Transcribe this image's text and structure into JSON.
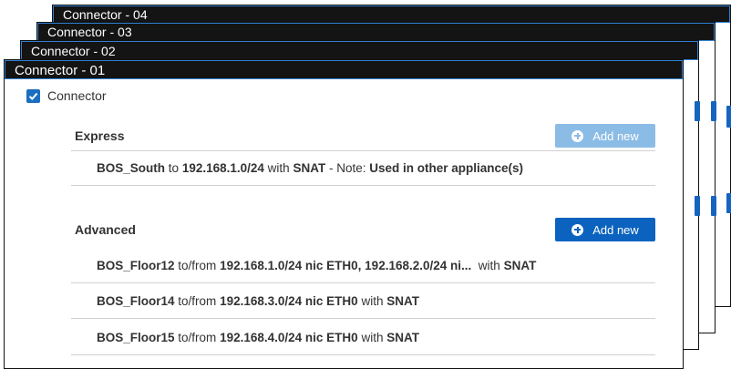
{
  "cards": [
    {
      "title": "Connector - 04"
    },
    {
      "title": "Connector - 03"
    },
    {
      "title": "Connector - 02"
    },
    {
      "title": "Connector - 01"
    }
  ],
  "connector_checkbox": {
    "label": "Connector",
    "checked": true
  },
  "express": {
    "title": "Express",
    "add_button": "Add new",
    "rows": [
      {
        "name": "BOS_South",
        "t1": "to",
        "network": "192.168.1.0/24",
        "t2": "with",
        "snat": "SNAT",
        "t3": "- Note:",
        "note": "Used in other appliance(s)"
      }
    ]
  },
  "advanced": {
    "title": "Advanced",
    "add_button": "Add new",
    "rows": [
      {
        "name": "BOS_Floor12",
        "t1": "to/from",
        "networks": "192.168.1.0/24 nic ETH0, 192.168.2.0/24 ni...",
        "t2": "with",
        "snat": "SNAT"
      },
      {
        "name": "BOS_Floor14",
        "t1": "to/from",
        "networks": "192.168.3.0/24 nic ETH0",
        "t2": "with",
        "snat": "SNAT"
      },
      {
        "name": "BOS_Floor15",
        "t1": "to/from",
        "networks": "192.168.4.0/24 nic ETH0",
        "t2": "with",
        "snat": "SNAT"
      }
    ]
  },
  "colors": {
    "header_bg": "#141414",
    "primary_button": "#0b63bf",
    "disabled_button": "#8bbce6",
    "checkbox": "#1a6fc0"
  }
}
